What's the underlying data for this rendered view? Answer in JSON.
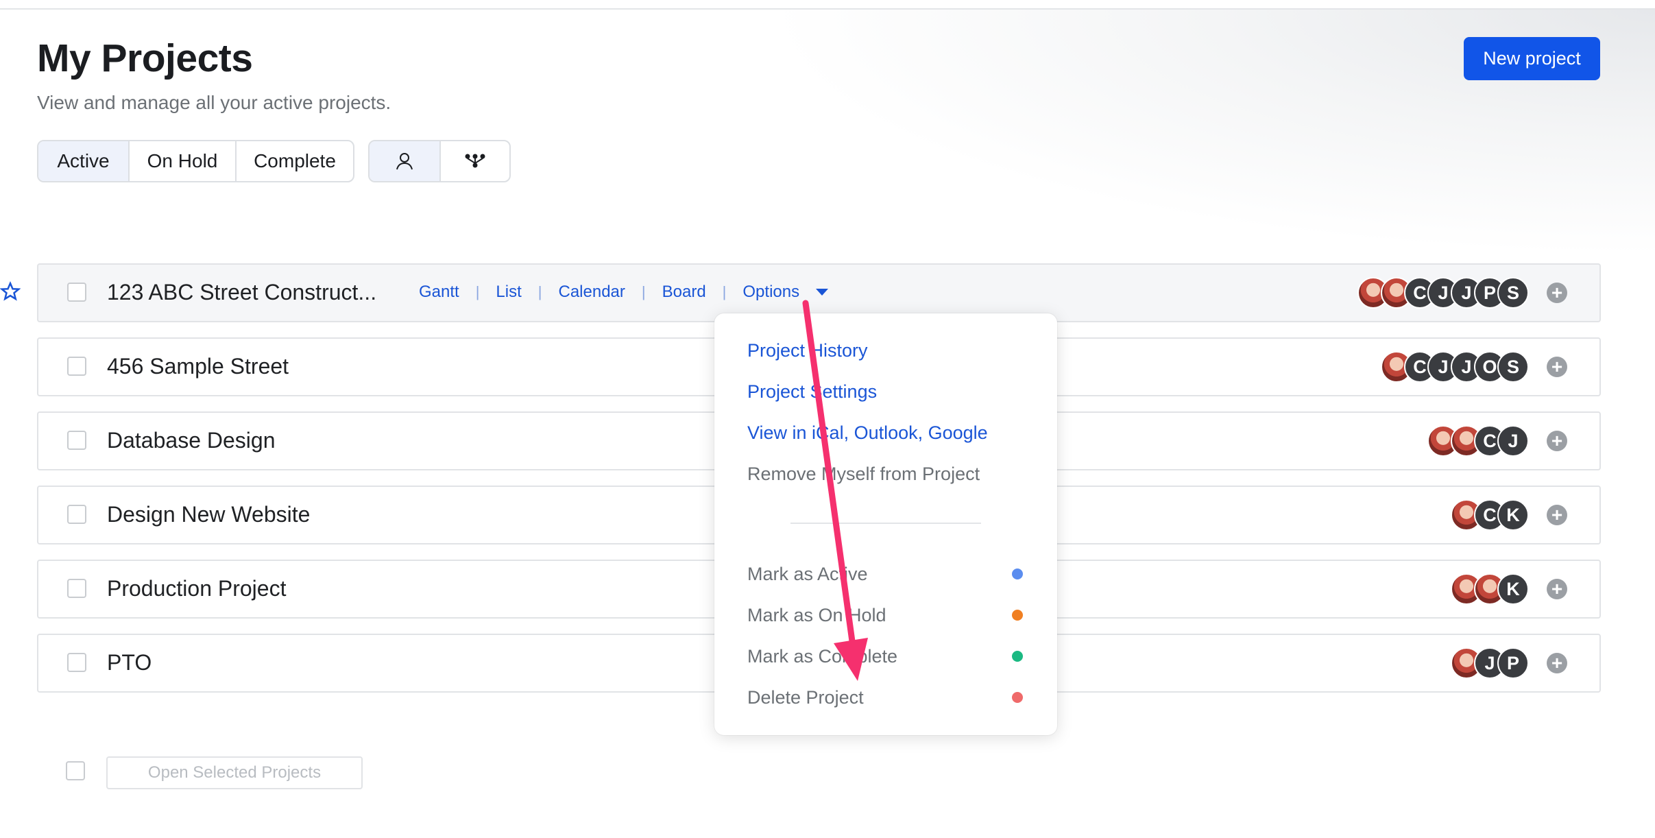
{
  "header": {
    "title": "My Projects",
    "subtitle": "View and manage all your active projects.",
    "new_project_label": "New project"
  },
  "status_tabs": [
    {
      "label": "Active",
      "selected": true
    },
    {
      "label": "On Hold",
      "selected": false
    },
    {
      "label": "Complete",
      "selected": false
    }
  ],
  "view_toggle": [
    {
      "icon": "person-icon"
    },
    {
      "icon": "hierarchy-icon"
    }
  ],
  "project_views": [
    "Gantt",
    "List",
    "Calendar",
    "Board",
    "Options"
  ],
  "projects": [
    {
      "name": "123 ABC Street Construct...",
      "starred": true,
      "avatars": [
        "photo",
        "photo",
        "C",
        "J",
        "J",
        "P",
        "S"
      ]
    },
    {
      "name": "456 Sample Street",
      "starred": false,
      "avatars": [
        "photo",
        "C",
        "J",
        "J",
        "O",
        "S"
      ]
    },
    {
      "name": "Database Design",
      "starred": false,
      "avatars": [
        "photo",
        "photo",
        "C",
        "J"
      ]
    },
    {
      "name": "Design New Website",
      "starred": false,
      "avatars": [
        "photo",
        "C",
        "K"
      ]
    },
    {
      "name": "Production Project",
      "starred": false,
      "avatars": [
        "photo",
        "photo",
        "K"
      ]
    },
    {
      "name": "PTO",
      "starred": false,
      "avatars": [
        "photo",
        "J",
        "P"
      ]
    }
  ],
  "options_menu": {
    "links": [
      "Project History",
      "Project Settings",
      "View in iCal, Outlook, Google"
    ],
    "remove_label": "Remove Myself from Project",
    "status_items": [
      {
        "label": "Mark as Active",
        "color": "#5b8def"
      },
      {
        "label": "Mark as On Hold",
        "color": "#f07f22"
      },
      {
        "label": "Mark as Complete",
        "color": "#1bb982"
      },
      {
        "label": "Delete Project",
        "color": "#ef6a6a"
      }
    ]
  },
  "footer": {
    "open_selected_label": "Open Selected Projects"
  },
  "colors": {
    "accent": "#1155e8",
    "link": "#1a55d6",
    "annotation_arrow": "#f5306e"
  }
}
